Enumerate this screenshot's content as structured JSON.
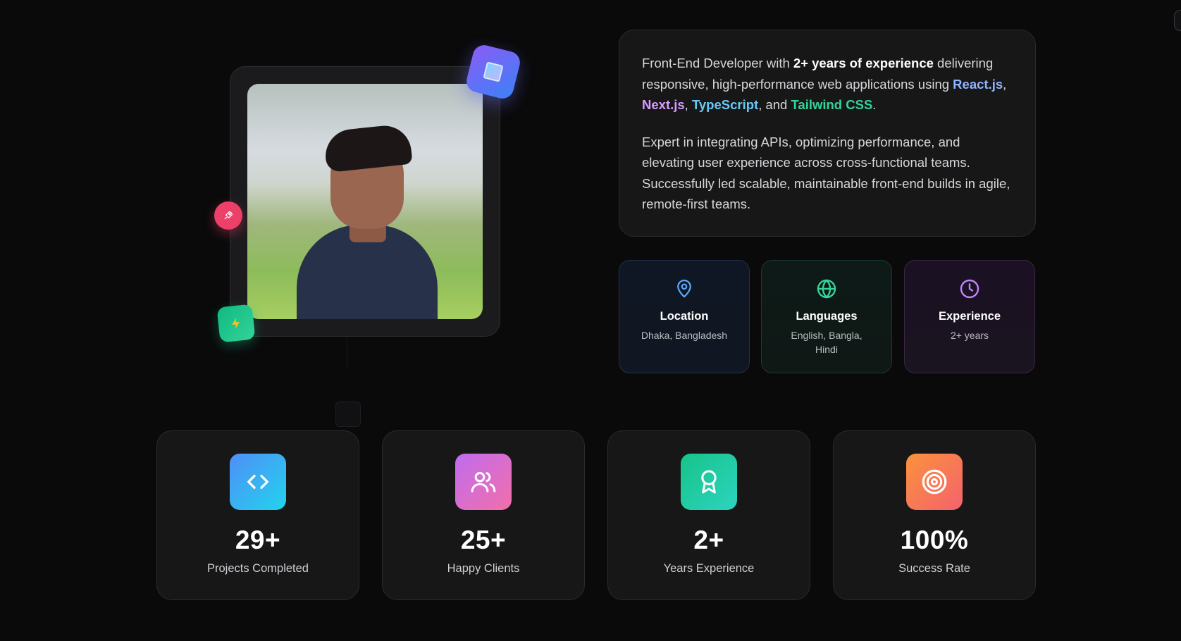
{
  "bio": {
    "p1_before": "Front-End Developer with ",
    "p1_strong": "2+ years of experience",
    "p1_middle": " delivering responsive, high-performance web applications using ",
    "tech_react": "React.js",
    "sep1": ", ",
    "tech_next": "Next.js",
    "sep2": ", ",
    "tech_ts": "TypeScript",
    "sep3": ", and ",
    "tech_tailwind": "Tailwind CSS",
    "p1_end": ".",
    "p2": "Expert in integrating APIs, optimizing performance, and elevating user experience across cross-functional teams. Successfully led scalable, maintainable front-end builds in agile, remote-first teams."
  },
  "info_cards": [
    {
      "icon": "map-pin-icon",
      "label": "Location",
      "value": "Dhaka, Bangladesh",
      "color": "#60a5fa"
    },
    {
      "icon": "globe-icon",
      "label": "Languages",
      "value": "English, Bangla, Hindi",
      "color": "#34d399"
    },
    {
      "icon": "clock-icon",
      "label": "Experience",
      "value": "2+ years",
      "color": "#c084fc"
    }
  ],
  "stats": [
    {
      "icon": "code-icon",
      "value": "29+",
      "label": "Projects Completed"
    },
    {
      "icon": "users-icon",
      "value": "25+",
      "label": "Happy Clients"
    },
    {
      "icon": "award-icon",
      "value": "2+",
      "label": "Years Experience"
    },
    {
      "icon": "target-icon",
      "value": "100%",
      "label": "Success Rate"
    }
  ],
  "badges": {
    "top": "cube-icon",
    "left": "rocket-icon",
    "bottom": "lightning-icon"
  },
  "colors": {
    "background": "#0a0a0b",
    "card": "#171718",
    "react": "#8fb4ff",
    "next": "#d59cff",
    "typescript": "#67c9f5",
    "tailwind": "#34d399"
  }
}
